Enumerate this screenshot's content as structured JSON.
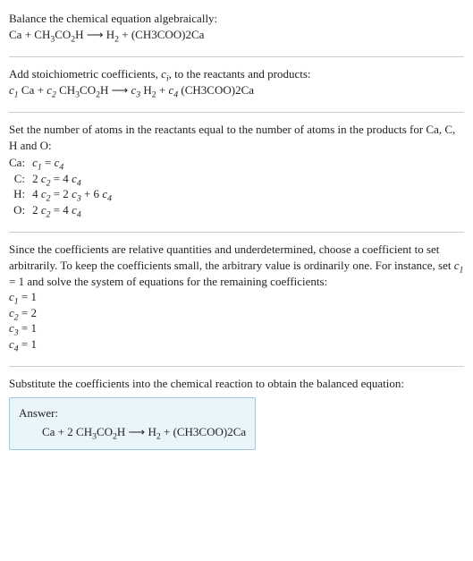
{
  "header": {
    "title": "Balance the chemical equation algebraically:",
    "equation_parts": {
      "r1": "Ca",
      "plus1": " + ",
      "r2_a": "CH",
      "r2_b": "3",
      "r2_c": "CO",
      "r2_d": "2",
      "r2_e": "H",
      "arrow": "  ⟶  ",
      "p1_a": "H",
      "p1_b": "2",
      "plus2": " + ",
      "p2": "(CH3COO)2Ca"
    }
  },
  "step1": {
    "text_a": "Add stoichiometric coefficients, ",
    "ci_c": "c",
    "ci_i": "i",
    "text_b": ", to the reactants and products:",
    "c1": "c",
    "c1i": "1",
    "sp1": " Ca + ",
    "c2": "c",
    "c2i": "2",
    "sp2_a": " CH",
    "sp2_b": "3",
    "sp2_c": "CO",
    "sp2_d": "2",
    "sp2_e": "H",
    "arrow": "  ⟶  ",
    "c3": "c",
    "c3i": "3",
    "sp3_a": " H",
    "sp3_b": "2",
    "plus": " + ",
    "c4": "c",
    "c4i": "4",
    "sp4": " (CH3COO)2Ca"
  },
  "step2": {
    "intro": "Set the number of atoms in the reactants equal to the number of atoms in the products for Ca, C, H and O:",
    "rows": {
      "Ca_lab": "Ca:",
      "Ca_l": "c",
      "Ca_li": "1",
      "Ca_mid": " = ",
      "Ca_r": "c",
      "Ca_ri": "4",
      "C_lab": "C:",
      "C_l1": "2 ",
      "C_l2": "c",
      "C_l2i": "2",
      "C_mid": " = 4 ",
      "C_r": "c",
      "C_ri": "4",
      "H_lab": "H:",
      "H_l1": "4 ",
      "H_l2": "c",
      "H_l2i": "2",
      "H_mid": " = 2 ",
      "H_r1": "c",
      "H_r1i": "3",
      "H_plus": " + 6 ",
      "H_r2": "c",
      "H_r2i": "4",
      "O_lab": "O:",
      "O_l1": "2 ",
      "O_l2": "c",
      "O_l2i": "2",
      "O_mid": " = 4 ",
      "O_r": "c",
      "O_ri": "4"
    }
  },
  "step3": {
    "text_a": "Since the coefficients are relative quantities and underdetermined, choose a coefficient to set arbitrarily. To keep the coefficients small, the arbitrary value is ordinarily one. For instance, set ",
    "c1": "c",
    "c1i": "1",
    "text_b": " = 1 and solve the system of equations for the remaining coefficients:",
    "sol": {
      "l1a": "c",
      "l1b": "1",
      "l1c": " = 1",
      "l2a": "c",
      "l2b": "2",
      "l2c": " = 2",
      "l3a": "c",
      "l3b": "3",
      "l3c": " = 1",
      "l4a": "c",
      "l4b": "4",
      "l4c": " = 1"
    }
  },
  "step4": {
    "intro": "Substitute the coefficients into the chemical reaction to obtain the balanced equation:",
    "answer_label": "Answer:",
    "eq": {
      "a": "Ca + 2 CH",
      "b": "3",
      "c": "CO",
      "d": "2",
      "e": "H",
      "arrow": "  ⟶  ",
      "f": "H",
      "g": "2",
      "h": " + (CH3COO)2Ca"
    }
  }
}
